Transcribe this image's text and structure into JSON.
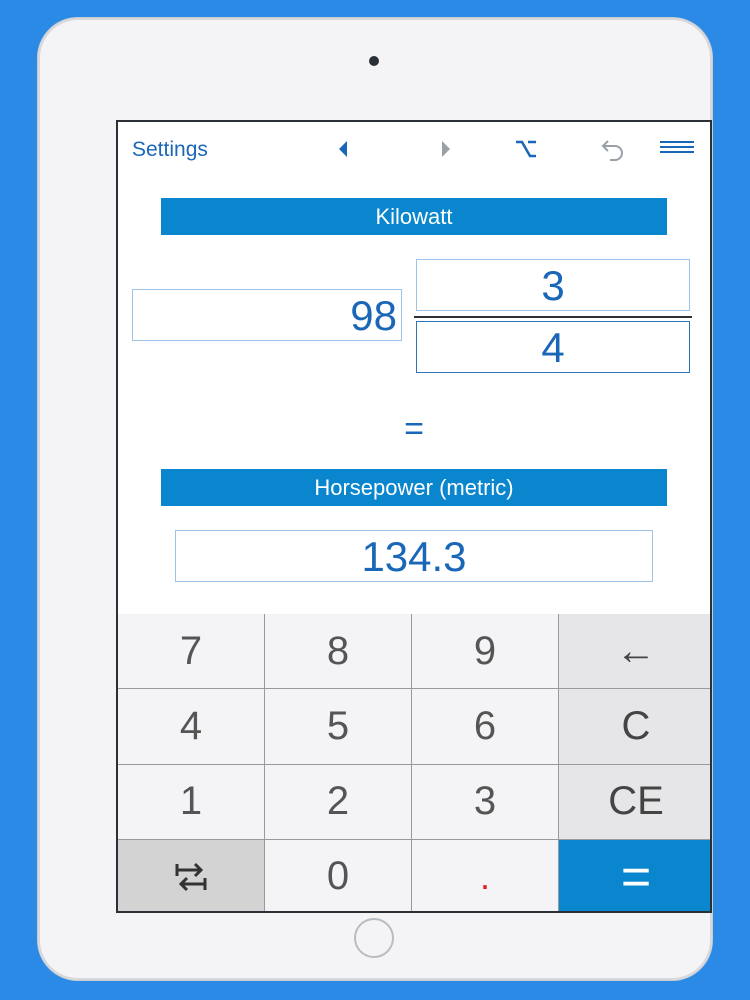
{
  "toolbar": {
    "settings_label": "Settings",
    "icons": [
      "left-arrow-icon",
      "right-arrow-icon",
      "option-icon",
      "undo-icon",
      "menu-icon"
    ]
  },
  "from_unit": {
    "name": "Kilowatt"
  },
  "input": {
    "whole": "98",
    "numerator": "3",
    "denominator": "4"
  },
  "equals": "=",
  "to_unit": {
    "name": "Horsepower (metric)"
  },
  "result": "134.3",
  "keypad": {
    "row1": [
      "7",
      "8",
      "9",
      "←"
    ],
    "row2": [
      "4",
      "5",
      "6",
      "C"
    ],
    "row3": [
      "1",
      "2",
      "3",
      "CE"
    ],
    "row4": {
      "zero": "0",
      "decimal": ".",
      "enter": "="
    }
  },
  "colors": {
    "accent": "#0a86cf",
    "text": "#1a67b8",
    "background": "#2a8ae6"
  }
}
